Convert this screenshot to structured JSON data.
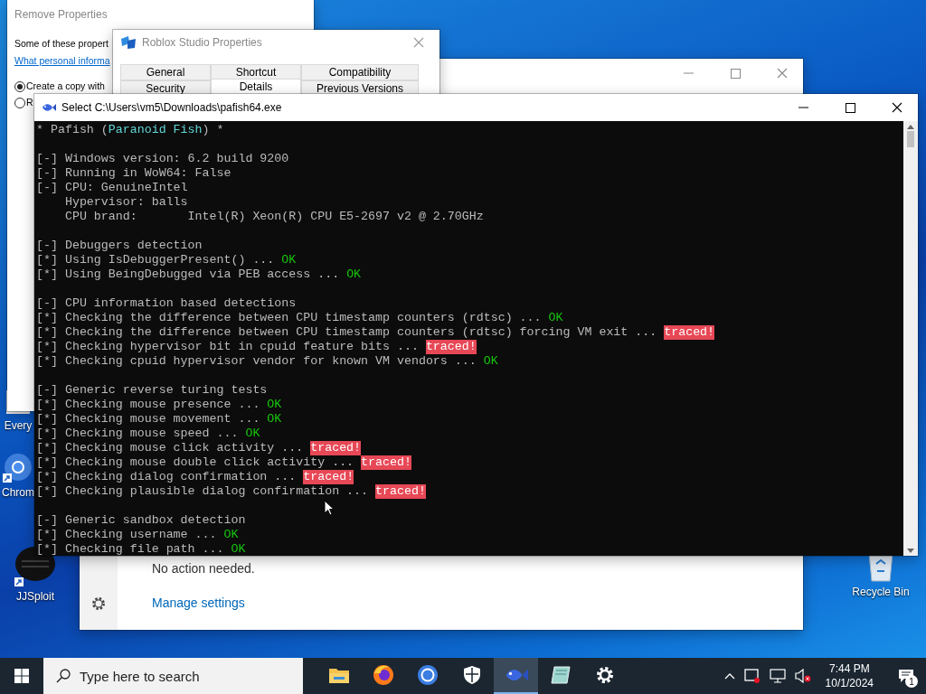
{
  "desktop_icons": [
    {
      "label": "Every",
      "kind": "app"
    },
    {
      "label": "Chrom",
      "kind": "chrome"
    },
    {
      "label": "JJSploit",
      "kind": "jj"
    },
    {
      "label": "Recycle Bin",
      "kind": "recycle"
    }
  ],
  "remove_properties": {
    "title": "Remove Properties",
    "text": "Some of these propert",
    "link": "What personal informa",
    "options": [
      {
        "label": "Create a copy with",
        "selected": true
      },
      {
        "label": "R",
        "selected": false
      }
    ]
  },
  "security_window": {
    "status": "No action needed.",
    "link": "Manage settings"
  },
  "properties_dialog": {
    "title": "Roblox Studio Properties",
    "tab_rows": [
      [
        {
          "label": "General",
          "selected": false
        },
        {
          "label": "Shortcut",
          "selected": false
        },
        {
          "label": "Compatibility",
          "selected": false
        }
      ],
      [
        {
          "label": "Security",
          "selected": false
        },
        {
          "label": "Details",
          "selected": true
        },
        {
          "label": "Previous Versions",
          "selected": false
        }
      ]
    ]
  },
  "console": {
    "title": "Select C:\\Users\\vm5\\Downloads\\pafish64.exe",
    "lines": [
      {
        "kind": "text",
        "parts": [
          {
            "text": "* Pafish (",
            "kind": "plain"
          },
          {
            "text": "Paranoid Fish",
            "kind": "accent"
          },
          {
            "text": ") *",
            "kind": "plain"
          }
        ]
      },
      {
        "kind": "blank"
      },
      {
        "kind": "text",
        "parts": [
          {
            "text": "[-] Windows version: 6.2 build 9200",
            "kind": "plain"
          }
        ]
      },
      {
        "kind": "text",
        "parts": [
          {
            "text": "[-] Running in WoW64: False",
            "kind": "plain"
          }
        ]
      },
      {
        "kind": "text",
        "parts": [
          {
            "text": "[-] CPU: GenuineIntel",
            "kind": "plain"
          }
        ]
      },
      {
        "kind": "text",
        "parts": [
          {
            "text": "    Hypervisor: balls",
            "kind": "plain"
          }
        ]
      },
      {
        "kind": "text",
        "parts": [
          {
            "text": "    CPU brand:       Intel(R) Xeon(R) CPU E5-2697 v2 @ 2.70GHz",
            "kind": "plain"
          }
        ]
      },
      {
        "kind": "blank"
      },
      {
        "kind": "text",
        "parts": [
          {
            "text": "[-] Debuggers detection",
            "kind": "plain"
          }
        ]
      },
      {
        "kind": "text",
        "parts": [
          {
            "text": "[*] Using IsDebuggerPresent() ... ",
            "kind": "plain"
          },
          {
            "text": "OK",
            "kind": "ok"
          }
        ]
      },
      {
        "kind": "text",
        "parts": [
          {
            "text": "[*] Using BeingDebugged via PEB access ... ",
            "kind": "plain"
          },
          {
            "text": "OK",
            "kind": "ok"
          }
        ]
      },
      {
        "kind": "blank"
      },
      {
        "kind": "text",
        "parts": [
          {
            "text": "[-] CPU information based detections",
            "kind": "plain"
          }
        ]
      },
      {
        "kind": "text",
        "parts": [
          {
            "text": "[*] Checking the difference between CPU timestamp counters (rdtsc) ... ",
            "kind": "plain"
          },
          {
            "text": "OK",
            "kind": "ok"
          }
        ]
      },
      {
        "kind": "text",
        "parts": [
          {
            "text": "[*] Checking the difference between CPU timestamp counters (rdtsc) forcing VM exit ... ",
            "kind": "plain"
          },
          {
            "text": "traced!",
            "kind": "traced"
          }
        ]
      },
      {
        "kind": "text",
        "parts": [
          {
            "text": "[*] Checking hypervisor bit in cpuid feature bits ... ",
            "kind": "plain"
          },
          {
            "text": "traced!",
            "kind": "traced"
          }
        ]
      },
      {
        "kind": "text",
        "parts": [
          {
            "text": "[*] Checking cpuid hypervisor vendor for known VM vendors ... ",
            "kind": "plain"
          },
          {
            "text": "OK",
            "kind": "ok"
          }
        ]
      },
      {
        "kind": "blank"
      },
      {
        "kind": "text",
        "parts": [
          {
            "text": "[-] Generic reverse turing tests",
            "kind": "plain"
          }
        ]
      },
      {
        "kind": "text",
        "parts": [
          {
            "text": "[*] Checking mouse presence ... ",
            "kind": "plain"
          },
          {
            "text": "OK",
            "kind": "ok"
          }
        ]
      },
      {
        "kind": "text",
        "parts": [
          {
            "text": "[*] Checking mouse movement ... ",
            "kind": "plain"
          },
          {
            "text": "OK",
            "kind": "ok"
          }
        ]
      },
      {
        "kind": "text",
        "parts": [
          {
            "text": "[*] Checking mouse speed ... ",
            "kind": "plain"
          },
          {
            "text": "OK",
            "kind": "ok"
          }
        ]
      },
      {
        "kind": "text",
        "parts": [
          {
            "text": "[*] Checking mouse click activity ... ",
            "kind": "plain"
          },
          {
            "text": "traced!",
            "kind": "traced"
          }
        ]
      },
      {
        "kind": "text",
        "parts": [
          {
            "text": "[*] Checking mouse double click activity ... ",
            "kind": "plain"
          },
          {
            "text": "traced!",
            "kind": "traced"
          }
        ]
      },
      {
        "kind": "text",
        "parts": [
          {
            "text": "[*] Checking dialog confirmation ... ",
            "kind": "plain"
          },
          {
            "text": "traced!",
            "kind": "traced"
          }
        ]
      },
      {
        "kind": "text",
        "parts": [
          {
            "text": "[*] Checking plausible dialog confirmation ... ",
            "kind": "plain"
          },
          {
            "text": "traced!",
            "kind": "traced"
          }
        ]
      },
      {
        "kind": "blank"
      },
      {
        "kind": "text",
        "parts": [
          {
            "text": "[-] Generic sandbox detection",
            "kind": "plain"
          }
        ]
      },
      {
        "kind": "text",
        "parts": [
          {
            "text": "[*] Checking username ... ",
            "kind": "plain"
          },
          {
            "text": "OK",
            "kind": "ok"
          }
        ]
      },
      {
        "kind": "text",
        "parts": [
          {
            "text": "[*] Checking file path ... ",
            "kind": "plain"
          },
          {
            "text": "OK",
            "kind": "ok"
          }
        ]
      }
    ]
  },
  "taskbar": {
    "search": {
      "placeholder": "Type here to search"
    },
    "apps": [
      {
        "kind": "explorer",
        "selected": false
      },
      {
        "kind": "firefox",
        "selected": false
      },
      {
        "kind": "ring",
        "selected": false
      },
      {
        "kind": "shield",
        "selected": false
      },
      {
        "kind": "fish",
        "selected": true
      },
      {
        "kind": "notebook",
        "selected": false
      },
      {
        "kind": "settings",
        "selected": false
      }
    ],
    "time": "7:44 PM",
    "date": "10/1/2024",
    "notifications": "1"
  }
}
